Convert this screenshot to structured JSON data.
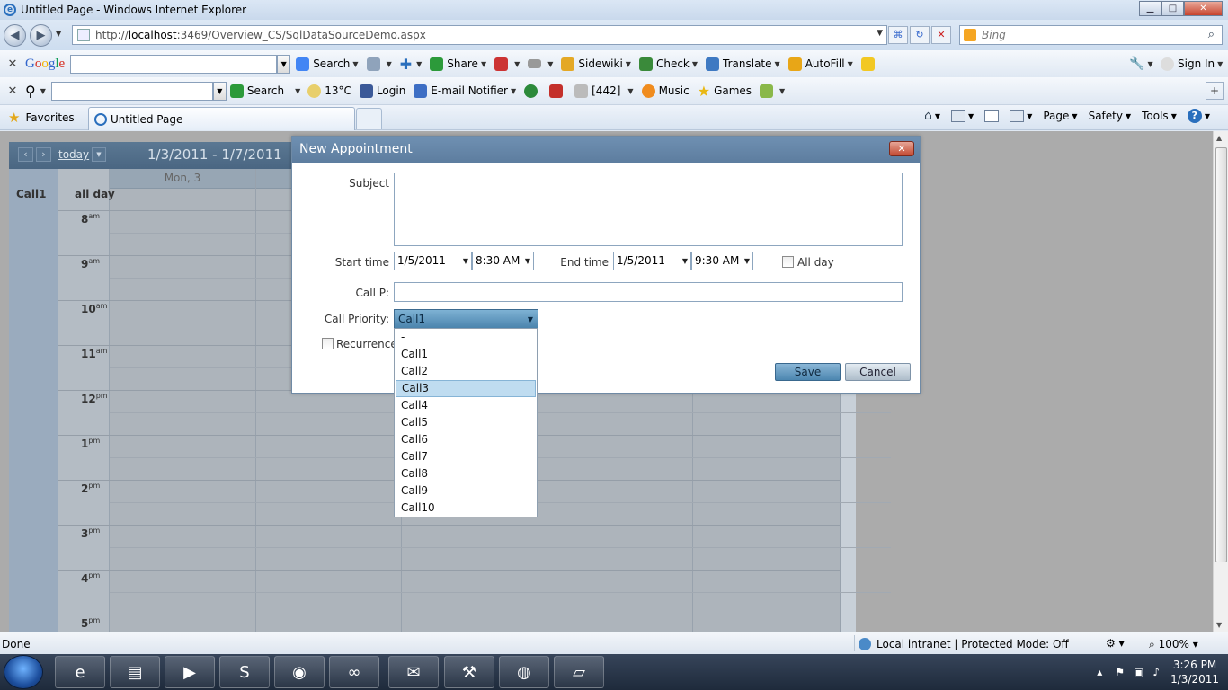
{
  "window": {
    "title": "Untitled Page - Windows Internet Explorer",
    "minimize": "▁",
    "maximize": "□",
    "close": "✕"
  },
  "address_bar": {
    "url_prefix": "http://",
    "url_host": "localhost",
    "url_rest": ":3469/Overview_CS/SqlDataSourceDemo.aspx",
    "search_placeholder": "Bing"
  },
  "google_toolbar": {
    "logo": "Google",
    "search": "Search",
    "share": "Share",
    "sidewiki": "Sidewiki",
    "check": "Check",
    "translate": "Translate",
    "autofill": "AutoFill",
    "sign_in": "Sign In"
  },
  "second_toolbar": {
    "search": "Search",
    "weather": "13°C",
    "login": "Login",
    "email_notifier": "E-mail Notifier",
    "count": "[442]",
    "music": "Music",
    "games": "Games"
  },
  "favorites_bar": {
    "favorites": "Favorites",
    "tab_title": "Untitled Page",
    "page": "Page",
    "safety": "Safety",
    "tools": "Tools"
  },
  "scheduler": {
    "today": "today",
    "date_range": "1/3/2011 - 1/7/2011",
    "day_header": "Mon, 3",
    "resource": "Call1",
    "all_day": "all day",
    "hours": [
      {
        "h": "8",
        "ap": "am"
      },
      {
        "h": "9",
        "ap": "am"
      },
      {
        "h": "10",
        "ap": "am"
      },
      {
        "h": "11",
        "ap": "am"
      },
      {
        "h": "12",
        "ap": "pm"
      },
      {
        "h": "1",
        "ap": "pm"
      },
      {
        "h": "2",
        "ap": "pm"
      },
      {
        "h": "3",
        "ap": "pm"
      },
      {
        "h": "4",
        "ap": "pm"
      },
      {
        "h": "5",
        "ap": "pm"
      }
    ]
  },
  "dialog": {
    "title": "New Appointment",
    "subject_label": "Subject",
    "start_label": "Start time",
    "start_date": "1/5/2011",
    "start_time": "8:30 AM",
    "end_label": "End time",
    "end_date": "1/5/2011",
    "end_time": "9:30 AM",
    "all_day_label": "All day",
    "call_p_label": "Call P:",
    "priority_label": "Call Priority:",
    "priority_value": "Call1",
    "recurrence_label": "Recurrence",
    "save": "Save",
    "cancel": "Cancel"
  },
  "priority_options": [
    "-",
    "Call1",
    "Call2",
    "Call3",
    "Call4",
    "Call5",
    "Call6",
    "Call7",
    "Call8",
    "Call9",
    "Call10"
  ],
  "priority_highlighted": "Call3",
  "status_bar": {
    "status": "Done",
    "zone": "Local intranet | Protected Mode: Off",
    "zoom": "100%"
  },
  "taskbar": {
    "time": "3:26 PM",
    "date": "1/3/2011"
  }
}
